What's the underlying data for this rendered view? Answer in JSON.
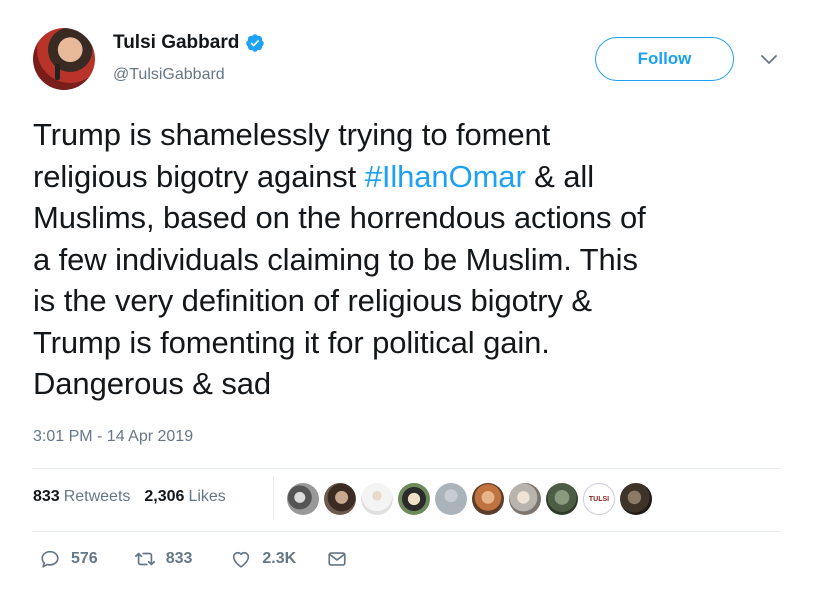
{
  "author": {
    "display_name": "Tulsi Gabbard",
    "handle": "@TulsiGabbard",
    "verified": true
  },
  "follow_button": {
    "label": "Follow"
  },
  "tweet": {
    "lines": [
      "Trump is shamelessly trying to foment",
      {
        "before": "religious bigotry against ",
        "hashtag": "#IlhanOmar",
        "after": " & all"
      },
      "Muslims, based on the horrendous actions of",
      "a few individuals claiming to be Muslim. This",
      "is the very definition of religious bigotry &",
      "Trump is fomenting it for political gain.",
      "Dangerous & sad"
    ],
    "timestamp": "3:01 PM - 14 Apr 2019"
  },
  "stats": {
    "retweets_count": "833",
    "retweets_label": "Retweets",
    "likes_count": "2,306",
    "likes_label": "Likes"
  },
  "likers_badge_text": "TULSI",
  "actions": {
    "replies": "576",
    "retweets": "833",
    "likes": "2.3K"
  },
  "colors": {
    "accent": "#1da1f2",
    "secondary_text": "#657786",
    "divider": "#e6ecf0"
  },
  "icons": [
    "verified-badge-icon",
    "chevron-down-icon",
    "reply-icon",
    "retweet-icon",
    "heart-icon",
    "direct-message-icon"
  ]
}
